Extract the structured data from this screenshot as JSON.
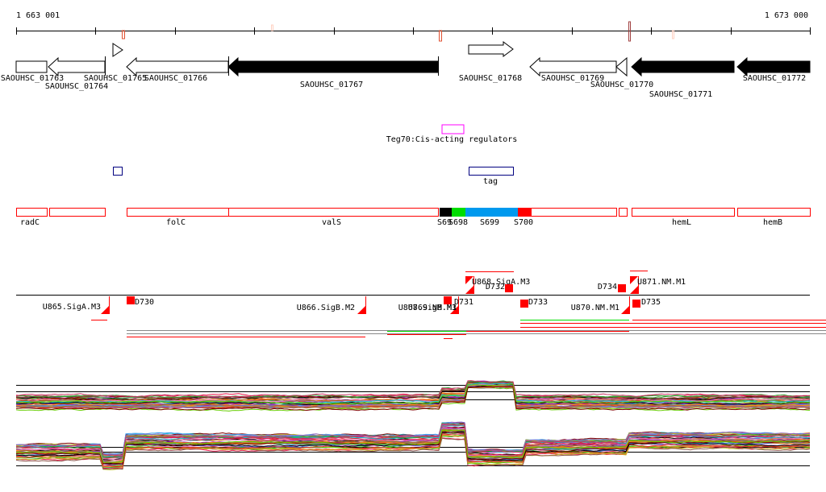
{
  "ruler": {
    "start_label": "1 663 001",
    "end_label": "1 673 000"
  },
  "genes": [
    {
      "name": "SAOUHSC_01763",
      "strand": "+",
      "style": "open"
    },
    {
      "name": "SAOUHSC_01764",
      "strand": "-",
      "style": "open"
    },
    {
      "name": "SAOUHSC_01765",
      "strand": "+",
      "style": "open"
    },
    {
      "name": "SAOUHSC_01766",
      "strand": "-",
      "style": "open"
    },
    {
      "name": "SAOUHSC_01767",
      "strand": "-",
      "style": "filled"
    },
    {
      "name": "SAOUHSC_01768",
      "strand": "+",
      "style": "open"
    },
    {
      "name": "SAOUHSC_01769",
      "strand": "-",
      "style": "open"
    },
    {
      "name": "SAOUHSC_01770",
      "strand": "-",
      "style": "open"
    },
    {
      "name": "SAOUHSC_01771",
      "strand": "-",
      "style": "filled"
    },
    {
      "name": "SAOUHSC_01772",
      "strand": "-",
      "style": "filled"
    }
  ],
  "regulators": {
    "label": "Teg70:Cis-acting regulators",
    "color": "#ff00ff"
  },
  "tags": {
    "label": "tag",
    "color": "#000080"
  },
  "operons": [
    "radC",
    "",
    "folC",
    "valS",
    "S69",
    "S698",
    "S699",
    "S700",
    "",
    "",
    "hemL",
    "hemB"
  ],
  "operon_colors": {
    "default": "#ff0000",
    "S69": "#000000",
    "S698": "#00dd00",
    "S699": "#0099ee",
    "S700": "#ff0000"
  },
  "transcripts": [
    "U865.SigA.M3",
    "D730",
    "U866.SigB.M2",
    "U867.SigB.M3",
    "U869.NM.M1",
    "D731",
    "U868.SigA.M3",
    "D732",
    "D733",
    "U870.NM.M1",
    "D734",
    "U871.NM.M1",
    "D735"
  ],
  "colors": {
    "accent": "#ff0000",
    "upshift": "#00dd00"
  }
}
